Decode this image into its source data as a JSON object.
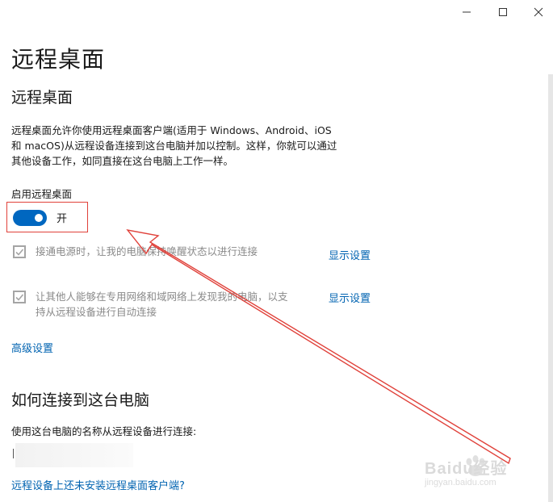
{
  "window": {
    "minimize_label": "最小化",
    "maximize_label": "最大化",
    "close_label": "关闭"
  },
  "page": {
    "title": "远程桌面"
  },
  "remote_desktop": {
    "heading": "远程桌面",
    "description_lines": [
      "远程桌面允许你使用远程桌面客户端(适用于 Windows、Android、iOS",
      "和 macOS)从远程设备连接到这台电脑并加以控制。这样，你就可以通过",
      "其他设备工作，如同直接在这台电脑上工作一样。"
    ],
    "enable_label": "启用远程桌面",
    "toggle_state": "开",
    "toggle_on": true,
    "options": [
      {
        "lines": [
          "接通电源时，让我的电脑保持唤醒状态以进行连接"
        ],
        "checked": true,
        "link": "显示设置"
      },
      {
        "lines": [
          "让其他人能够在专用网络和域网络上发现我的电脑，以支",
          "持从远程设备进行自动连接"
        ],
        "checked": true,
        "link": "显示设置"
      }
    ],
    "advanced_link": "高级设置"
  },
  "connect": {
    "heading": "如何连接到这台电脑",
    "instruction": "使用这台电脑的名称从远程设备进行连接:",
    "no_client_link": "远程设备上还未安装远程桌面客户端?"
  },
  "watermark": {
    "brand": "Baidu经验",
    "url": "jingyan.baidu.com"
  },
  "colors": {
    "accent": "#0067c0",
    "link": "#0063b1",
    "annotation": "#e0413a"
  }
}
